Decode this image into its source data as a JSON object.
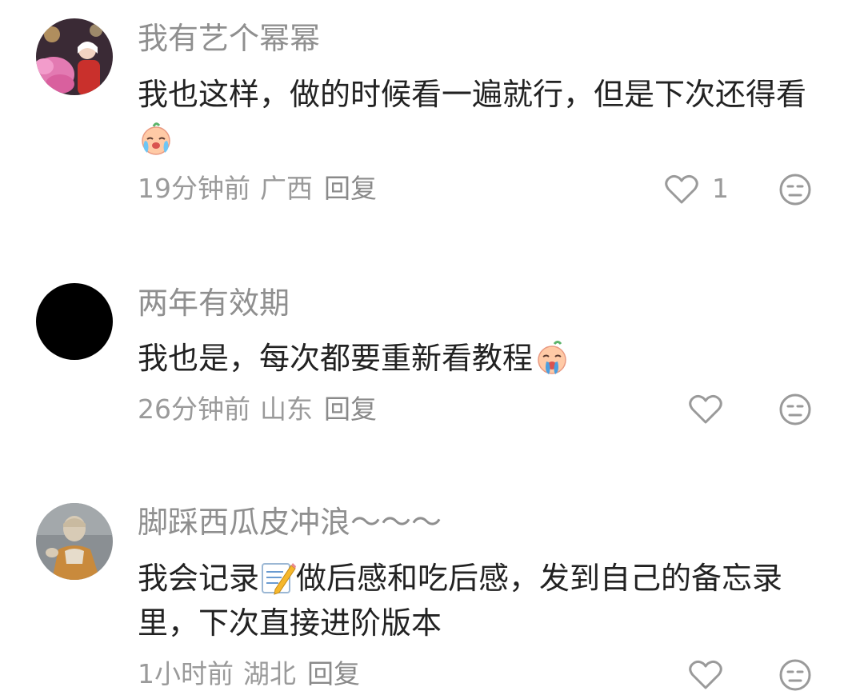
{
  "comments": [
    {
      "username": "我有艺个幂幂",
      "text_before": "我也这样，做的时候看一遍就行，但是下次还得看",
      "emoji": "crying-face-emoji",
      "text_after": "",
      "time": "19分钟前",
      "region": "广西",
      "reply_label": "回复",
      "likes": "1"
    },
    {
      "username": "两年有效期",
      "text_before": "我也是，每次都要重新看教程",
      "emoji": "crying-face-emoji",
      "text_after": "",
      "time": "26分钟前",
      "region": "山东",
      "reply_label": "回复",
      "likes": ""
    },
    {
      "username": "脚踩西瓜皮冲浪～～～",
      "text_before": "我会记录",
      "emoji": "memo-emoji",
      "text_after": "做后感和吃后感，发到自己的备忘录里，下次直接进阶版本",
      "time": "1小时前",
      "region": "湖北",
      "reply_label": "回复",
      "likes": ""
    }
  ],
  "colors": {
    "username": "#8f8f8f",
    "text": "#222222",
    "meta": "#9a9a9a",
    "icon": "#9a9a9a"
  }
}
